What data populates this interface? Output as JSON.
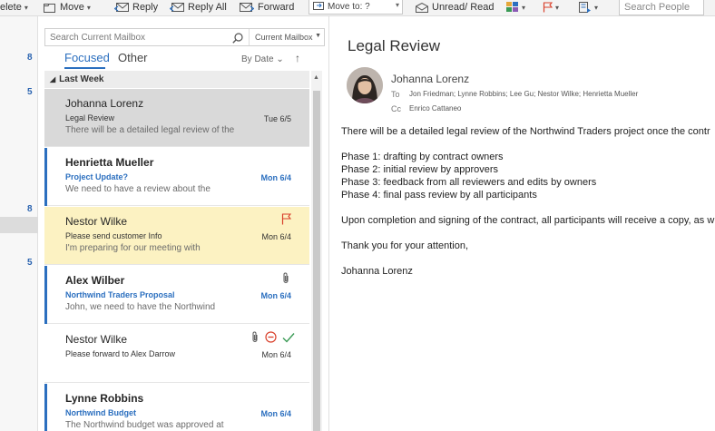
{
  "toolbar": {
    "delete_label": "elete",
    "move_label": "Move",
    "reply_label": "Reply",
    "reply_all_label": "Reply All",
    "forward_label": "Forward",
    "move_to_label": "Move to: ?",
    "unread_read_label": "Unread/ Read",
    "search_people_placeholder": "Search People"
  },
  "folder_pane": {
    "counts": [
      "8",
      "5",
      "8",
      "5"
    ]
  },
  "message_list": {
    "search_placeholder": "Search Current Mailbox",
    "search_scope": "Current Mailbox",
    "tabs": {
      "focused": "Focused",
      "other": "Other"
    },
    "sort_label": "By Date",
    "sort_arrow": "↑",
    "group_header": "Last Week",
    "messages": [
      {
        "from": "Johanna Lorenz",
        "subject": "Legal Review",
        "preview": "There will be a detailed legal review of the",
        "date": "Tue 6/5",
        "unread": false,
        "selected": true
      },
      {
        "from": "Henrietta Mueller",
        "subject": "Project Update?",
        "preview": "We need to have a review about the",
        "date": "Mon 6/4",
        "unread": true
      },
      {
        "from": "Nestor Wilke",
        "subject": "Please send customer Info",
        "preview": "I'm preparing for our meeting with",
        "date": "Mon 6/4",
        "unread": false,
        "flagged": true
      },
      {
        "from": "Alex Wilber",
        "subject": "Northwind Traders Proposal",
        "preview": "John, we need to have the Northwind",
        "date": "Mon 6/4",
        "unread": true,
        "attachment": true
      },
      {
        "from": "Nestor Wilke",
        "subject": "Please forward to Alex Darrow",
        "preview": "",
        "date": "Mon 6/4",
        "unread": false,
        "attachment": true
      },
      {
        "from": "Lynne Robbins",
        "subject": "Northwind Budget",
        "preview": "The Northwind budget was approved at",
        "date": "Mon 6/4",
        "unread": true
      }
    ]
  },
  "reading_pane": {
    "subject": "Legal Review",
    "sender": "Johanna Lorenz",
    "to_label": "To",
    "to": "Jon Friedman; Lynne Robbins; Lee Gu; Nestor Wilke; Henrietta Mueller",
    "cc_label": "Cc",
    "cc": "Enrico Cattaneo",
    "body": [
      "There will be a detailed legal review of the Northwind Traders project once the contr",
      "",
      "Phase 1: drafting by contract owners",
      "Phase 2: initial review by approvers",
      "Phase 3: feedback from all reviewers and edits by owners",
      "Phase 4: final pass review by all participants",
      "",
      "Upon completion and signing of the contract, all participants will receive a copy, as w",
      "",
      "Thank you for your attention,",
      "",
      "Johanna Lorenz"
    ]
  },
  "colors": {
    "accent": "#2b6fbf",
    "flag_red": "#d9402b",
    "check_green": "#3a9a55",
    "flagged_row": "#fcf2c2",
    "selected_row": "#d9d9d9"
  }
}
